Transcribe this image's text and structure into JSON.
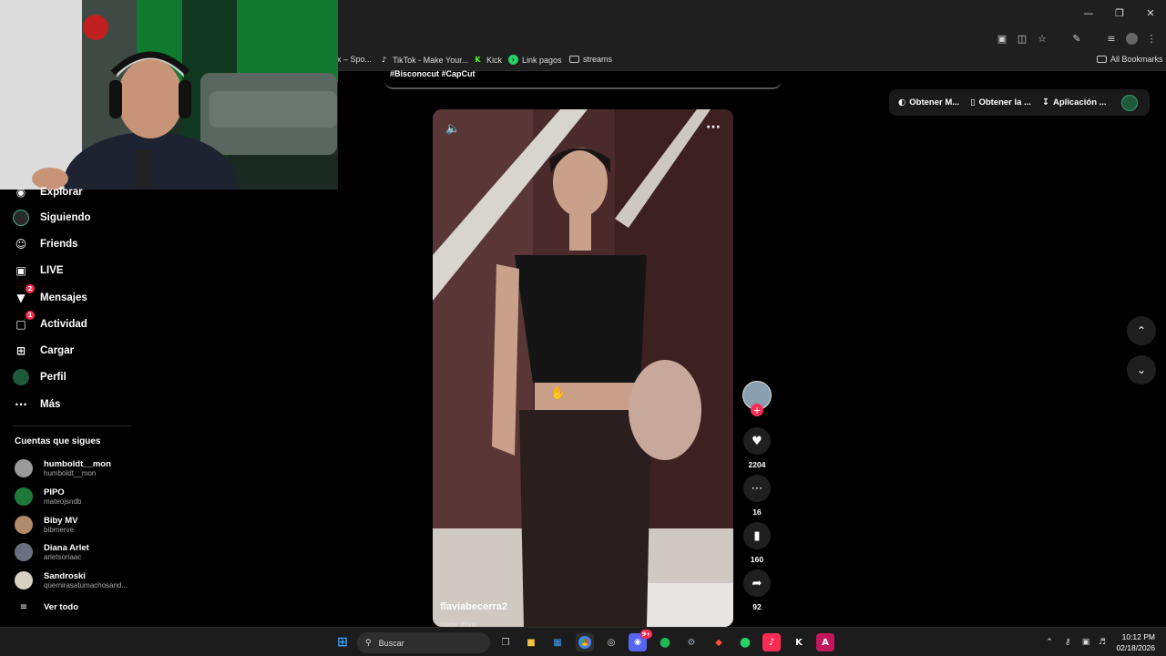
{
  "bookmarks": [
    {
      "label": "ix – Spo...",
      "icon": "music-icon",
      "color": "#1db954"
    },
    {
      "label": "TikTok - Make Your...",
      "icon": "tiktok-icon",
      "color": "#ffffff"
    },
    {
      "label": "Kick",
      "icon": "kick-icon",
      "color": "#53fc18"
    },
    {
      "label": "Link pagos",
      "icon": "link-icon",
      "color": "#25d366"
    },
    {
      "label": "streams",
      "icon": "folder-icon",
      "color": "#cccccc"
    }
  ],
  "all_bookmarks": "All Bookmarks",
  "sidebar": {
    "items": [
      {
        "label": "Explorar",
        "icon": "compass-icon"
      },
      {
        "label": "Siguiendo",
        "icon": "following-avatar-icon"
      },
      {
        "label": "Friends",
        "icon": "friends-icon"
      },
      {
        "label": "LIVE",
        "icon": "live-icon"
      },
      {
        "label": "Mensajes",
        "icon": "messages-icon",
        "badge": "2"
      },
      {
        "label": "Actividad",
        "icon": "activity-icon",
        "badge": "1"
      },
      {
        "label": "Cargar",
        "icon": "upload-icon"
      },
      {
        "label": "Perfil",
        "icon": "profile-avatar-icon"
      },
      {
        "label": "Más",
        "icon": "more-icon"
      }
    ],
    "following_title": "Cuentas que sigues",
    "accounts": [
      {
        "name": "humboldt__mon",
        "handle": "humboldt__mon",
        "color": "#9a9a9a"
      },
      {
        "name": "PIPO",
        "handle": "mateojsndb",
        "color": "#1f7a3a"
      },
      {
        "name": "Biby MV",
        "handle": "bibmerve",
        "color": "#b08a6a"
      },
      {
        "name": "Diana Arlet",
        "handle": "arletsoriaac",
        "color": "#6a7080"
      },
      {
        "name": "Sandroski",
        "handle": "quemirasatumachosand...",
        "color": "#d8d0c0"
      }
    ],
    "see_all": "Ver todo"
  },
  "top_actions": {
    "coins": "Obtener M...",
    "app": "Obtener la ...",
    "desktop": "Aplicación ..."
  },
  "prev_caption": "#Bisconocut #CapCut",
  "video": {
    "username": "flaviabecerra2",
    "tags": "#pov #fyp"
  },
  "actions": {
    "likes": "2204",
    "comments": "16",
    "saves": "160",
    "shares": "92"
  },
  "taskbar": {
    "search_label": "Buscar",
    "time": "10:12 PM",
    "date": "02/18/2026",
    "notif_badge": "9+"
  }
}
